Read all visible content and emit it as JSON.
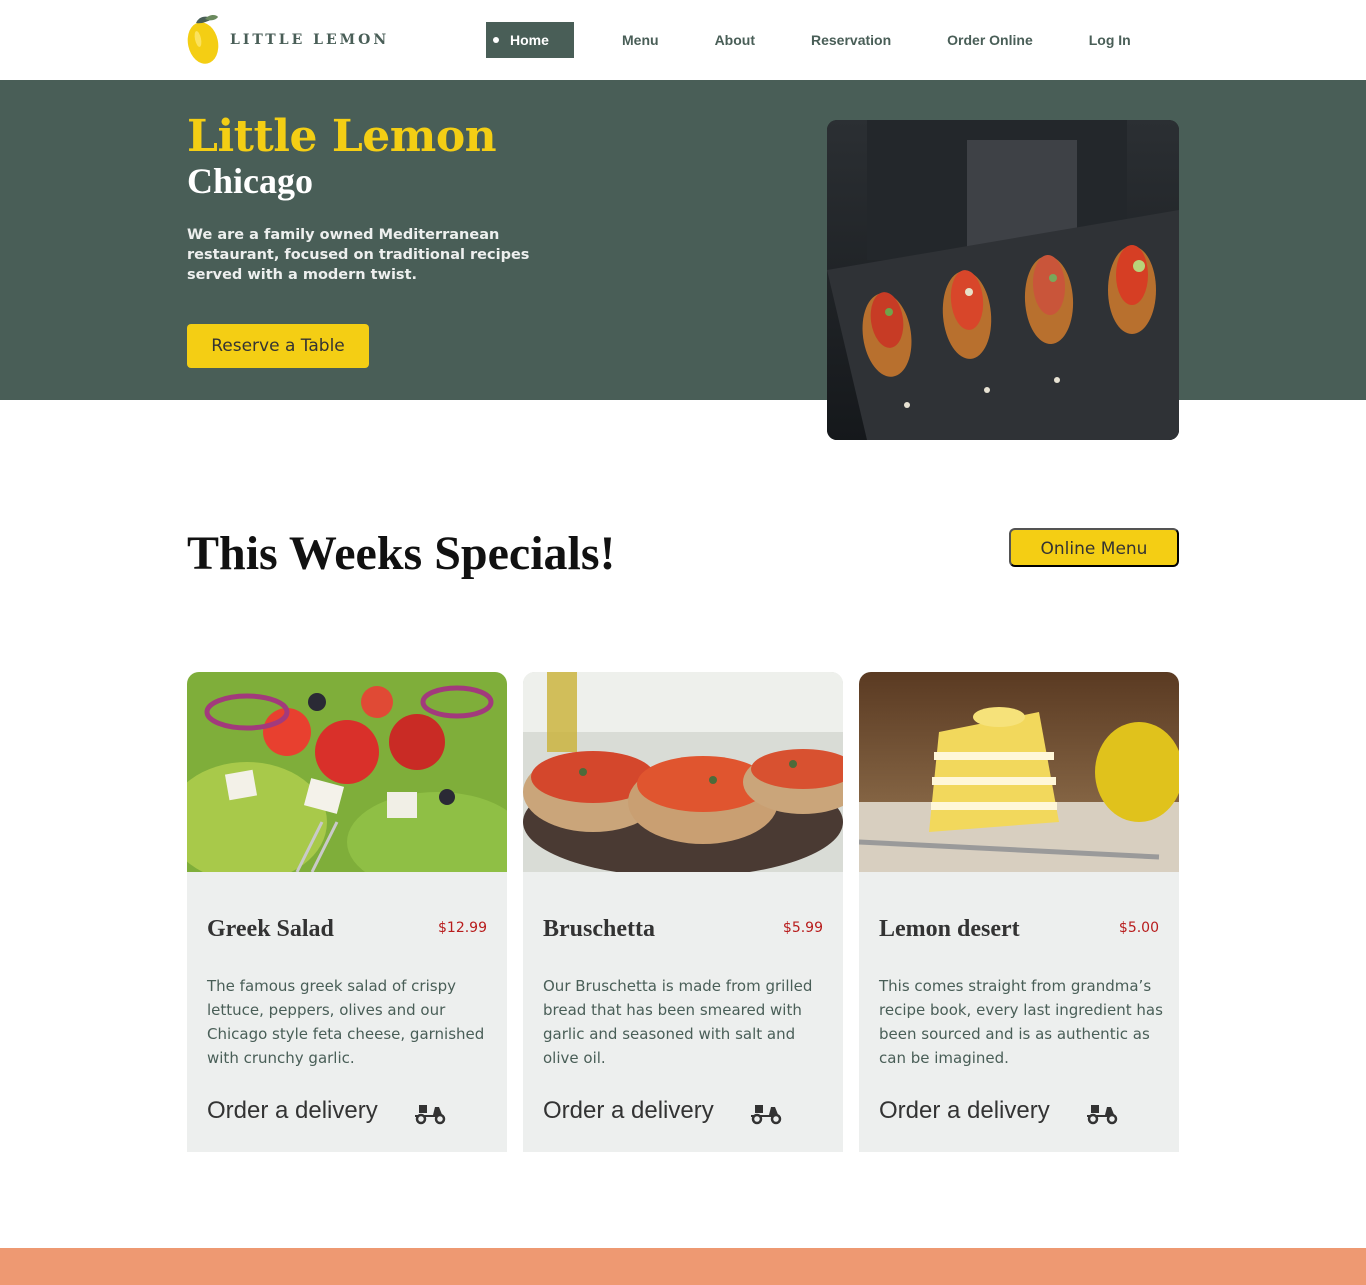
{
  "brand": {
    "name": "LITTLE LEMON",
    "logo_icon": "lemon-icon"
  },
  "nav": {
    "items": [
      {
        "label": "Home",
        "active": true
      },
      {
        "label": "Menu"
      },
      {
        "label": "About"
      },
      {
        "label": "Reservation"
      },
      {
        "label": "Order Online"
      },
      {
        "label": "Log In"
      }
    ]
  },
  "hero": {
    "title": "Little Lemon",
    "subtitle": "Chicago",
    "description": "We are a family owned Mediterranean restaurant, focused on traditional recipes served with a modern twist.",
    "cta_label": "Reserve a Table"
  },
  "specials": {
    "title": "This Weeks Specials!",
    "online_menu_label": "Online Menu",
    "cards": [
      {
        "name": "Greek Salad",
        "price": "$12.99",
        "description": "The famous greek salad of crispy lettuce, peppers, olives and our Chicago style feta cheese, garnished with crunchy garlic.",
        "order_label": "Order a delivery",
        "icon": "scooter-icon"
      },
      {
        "name": "Bruschetta",
        "price": "$5.99",
        "description": "Our Bruschetta is made from grilled bread that has been smeared with garlic and seasoned with salt and olive oil.",
        "order_label": "Order a delivery",
        "icon": "scooter-icon"
      },
      {
        "name": "Lemon desert",
        "price": "$5.00",
        "description": "This comes straight from grandma’s recipe book, every last ingredient has been sourced and is as authentic as can be imagined.",
        "order_label": "Order a delivery",
        "icon": "scooter-icon"
      }
    ]
  },
  "colors": {
    "primary_green": "#495e57",
    "primary_yellow": "#f4ce14",
    "highlight_light": "#edefee",
    "price_red": "#b81c1c",
    "footer_salmon": "#ee9972"
  }
}
